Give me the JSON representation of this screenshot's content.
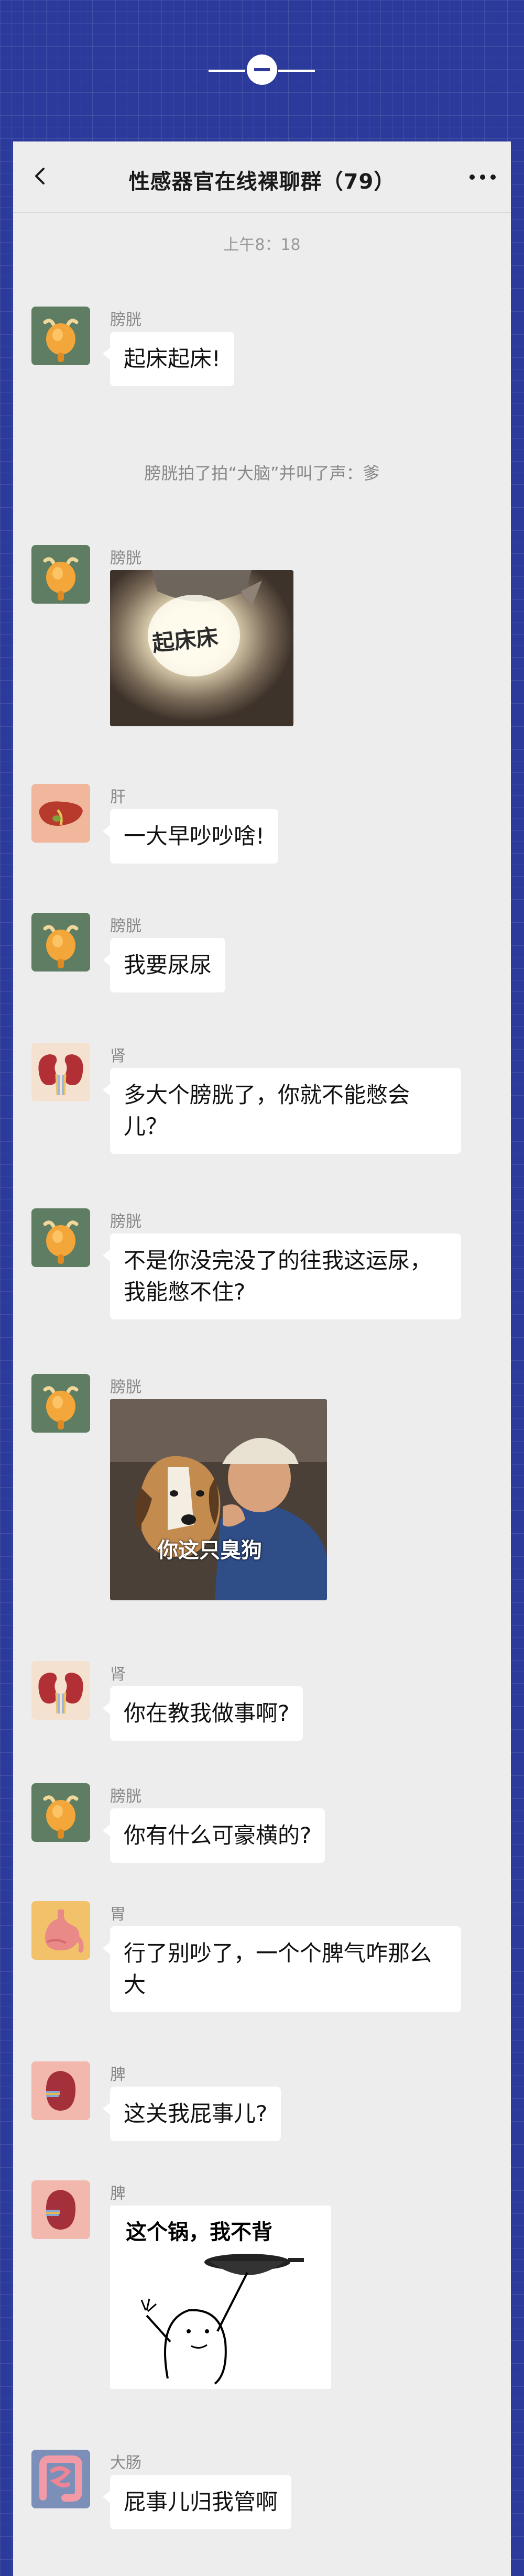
{
  "colors": {
    "page_bg": "#2b3a9b",
    "chat_bg": "#ededed",
    "bubble": "#ffffff",
    "accent": "#ffffff"
  },
  "header": {
    "title": "性感器官在线裸聊群（79）",
    "back_icon": "chevron-left-icon",
    "more_icon": "more-dots-icon"
  },
  "chat": {
    "time": "上午8：18",
    "system": "膀胱拍了拍“大脑”并叫了声：爹"
  },
  "messages": [
    {
      "sender": "膀胱",
      "avatar": "bladder-icon",
      "text": "起床起床!"
    },
    {
      "sender": "膀胱",
      "avatar": "bladder-icon",
      "image_caption": "起床床"
    },
    {
      "sender": "肝",
      "avatar": "liver-icon",
      "text": "一大早吵吵啥!"
    },
    {
      "sender": "膀胱",
      "avatar": "bladder-icon",
      "text": "我要尿尿"
    },
    {
      "sender": "肾",
      "avatar": "kidney-icon",
      "text": "多大个膀胱了，你就不能憋会儿？"
    },
    {
      "sender": "膀胱",
      "avatar": "bladder-icon",
      "text": "不是你没完没了的往我这运尿，我能憋不住?"
    },
    {
      "sender": "膀胱",
      "avatar": "bladder-icon",
      "image_caption": "你这只臭狗"
    },
    {
      "sender": "肾",
      "avatar": "kidney-icon",
      "text": "你在教我做事啊?"
    },
    {
      "sender": "膀胱",
      "avatar": "bladder-icon",
      "text": "你有什么可豪横的?"
    },
    {
      "sender": "胃",
      "avatar": "stomach-icon",
      "text": "行了别吵了，一个个脾气咋那么大"
    },
    {
      "sender": "脾",
      "avatar": "spleen-icon",
      "text": "这关我屁事儿?"
    },
    {
      "sender": "脾",
      "avatar": "spleen-icon",
      "image_caption": "这个锅，我不背"
    },
    {
      "sender": "大肠",
      "avatar": "intestine-icon",
      "text": "屁事儿归我管啊"
    }
  ]
}
